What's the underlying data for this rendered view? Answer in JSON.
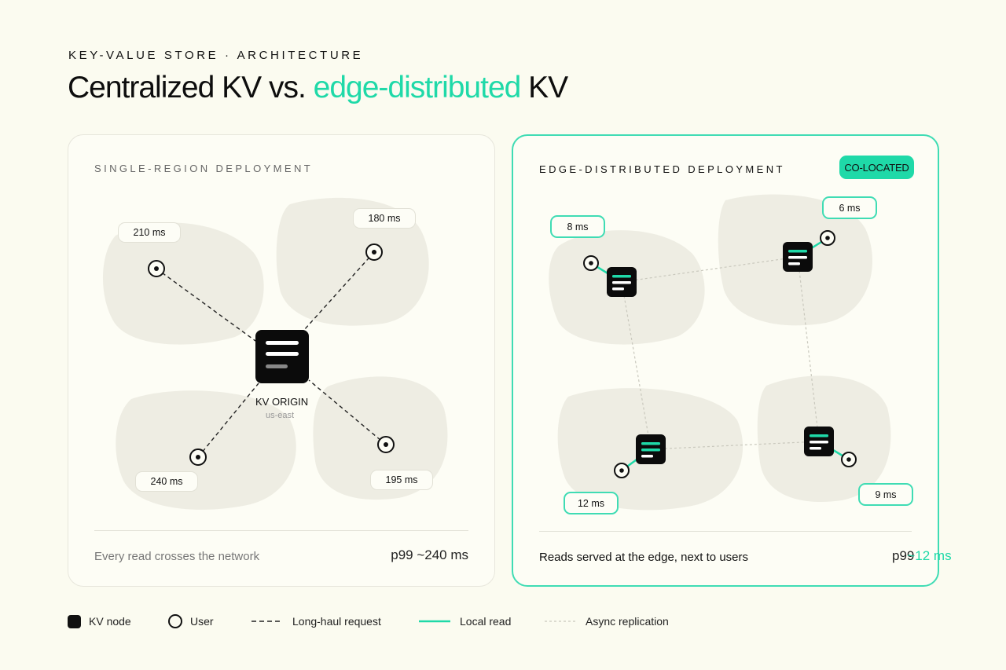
{
  "header": {
    "eyebrow": "KEY-VALUE STORE · ARCHITECTURE",
    "title_pre": "Centralized KV vs. ",
    "title_accent": "edge-distributed",
    "title_post": " KV"
  },
  "left_panel": {
    "label": "SINGLE-REGION DEPLOYMENT",
    "origin": {
      "label": "KV ORIGIN",
      "region": "us-east"
    },
    "latencies": [
      "210 ms",
      "180 ms",
      "240 ms",
      "195 ms"
    ],
    "footer_text": "Every read crosses the network",
    "footer_metric": "p99 ~240 ms"
  },
  "right_panel": {
    "label": "EDGE-DISTRIBUTED DEPLOYMENT",
    "badge": "CO-LOCATED",
    "latencies": [
      "8 ms",
      "6 ms",
      "12 ms",
      "9 ms"
    ],
    "footer_text": "Reads served at the edge, next to users",
    "footer_metric_a": "p99",
    "footer_metric_b": "~12 ms"
  },
  "legend": [
    {
      "icon": "kv-node-icon",
      "label": "KV node"
    },
    {
      "icon": "user-icon",
      "label": "User"
    },
    {
      "icon": "long-haul-line-icon",
      "label": "Long-haul request"
    },
    {
      "icon": "local-read-line-icon",
      "label": "Local read"
    },
    {
      "icon": "async-replication-line-icon",
      "label": "Async replication"
    }
  ],
  "colors": {
    "background": "#fbfbf0",
    "accent": "#1fd9a8",
    "node": "#111111",
    "blob": "#eeede3"
  }
}
